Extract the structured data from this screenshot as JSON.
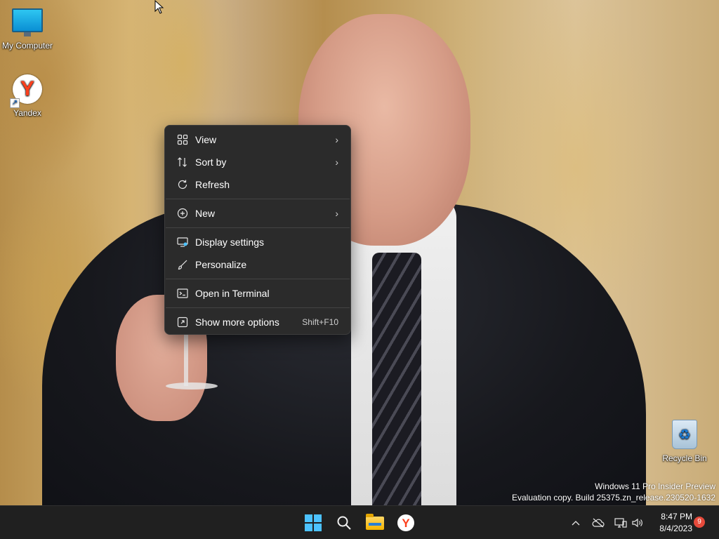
{
  "desktop": {
    "icons": [
      {
        "label": "My Computer",
        "icon": "monitor-icon"
      },
      {
        "label": "Yandex",
        "icon": "yandex-icon"
      },
      {
        "label": "Recycle Bin",
        "icon": "recycle-bin-icon"
      }
    ],
    "watermark": {
      "line1": "Windows 11 Pro Insider Preview",
      "line2": "Evaluation copy. Build 25375.zn_release.230520-1632"
    }
  },
  "context_menu": {
    "items": [
      {
        "label": "View",
        "icon": "grid-icon",
        "submenu": true
      },
      {
        "label": "Sort by",
        "icon": "sort-icon",
        "submenu": true
      },
      {
        "label": "Refresh",
        "icon": "refresh-icon"
      },
      {
        "label": "New",
        "icon": "plus-circle-icon",
        "submenu": true
      },
      {
        "label": "Display settings",
        "icon": "display-icon"
      },
      {
        "label": "Personalize",
        "icon": "brush-icon"
      },
      {
        "label": "Open in Terminal",
        "icon": "terminal-icon"
      },
      {
        "label": "Show more options",
        "icon": "expand-icon",
        "shortcut": "Shift+F10"
      }
    ]
  },
  "taskbar": {
    "apps": [
      "start-icon",
      "search-icon",
      "file-explorer-icon",
      "yandex-icon"
    ],
    "tray_icons": [
      "chevron-up-icon",
      "cloud-off-icon",
      "network-icon",
      "speaker-icon"
    ],
    "clock": {
      "time": "8:47 PM",
      "date": "8/4/2023"
    },
    "notification_count": "9"
  },
  "colors": {
    "menu_bg": "#2b2b2b",
    "taskbar_bg": "#202020",
    "accent": "#4cc2ff",
    "yandex_red": "#fc3f1d",
    "badge_red": "#e64a3b"
  }
}
